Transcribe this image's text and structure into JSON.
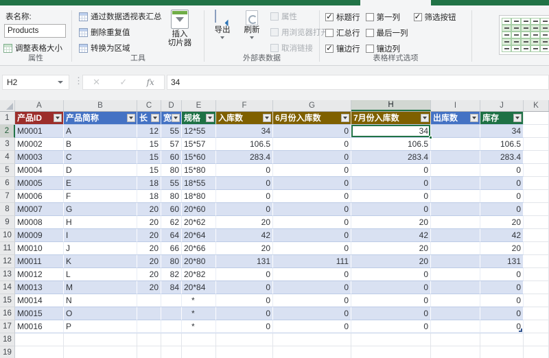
{
  "app": {
    "name": "Excel table tools ribbon - Design tab"
  },
  "colors": {
    "excel_green": "#217346",
    "header_red": "#9C2E2B",
    "header_blue": "#4472C4",
    "header_green": "#1E7145",
    "header_olive": "#7F6000",
    "banded_row_blue": "#D9E1F2"
  },
  "ribbon": {
    "properties_group": {
      "label": "属性",
      "table_name_label": "表名称:",
      "table_name_value": "Products",
      "resize_table": "调整表格大小"
    },
    "tools_group": {
      "label": "工具",
      "summarize_pivot": "通过数据透视表汇总",
      "remove_duplicates": "删除重复值",
      "convert_to_range": "转换为区域",
      "insert_slicer_line1": "插入",
      "insert_slicer_line2": "切片器"
    },
    "external_group": {
      "label": "外部表数据",
      "export": "导出",
      "refresh": "刷新",
      "properties_item": "属性",
      "open_in_browser": "用浏览器打开",
      "unlink": "取消链接"
    },
    "style_options_group": {
      "label": "表格样式选项",
      "checkbox_columns": [
        [
          {
            "label": "标题行",
            "checked": true
          },
          {
            "label": "汇总行",
            "checked": false
          },
          {
            "label": "镶边行",
            "checked": true
          }
        ],
        [
          {
            "label": "第一列",
            "checked": false
          },
          {
            "label": "最后一列",
            "checked": false
          },
          {
            "label": "镶边列",
            "checked": false
          }
        ],
        [
          {
            "label": "筛选按钮",
            "checked": true
          }
        ]
      ]
    }
  },
  "formula_bar": {
    "name_box": "H2",
    "cancel_icon": "✕",
    "enter_icon": "✓",
    "fx_icon": "fx",
    "formula_value": "34"
  },
  "grid": {
    "column_letters": [
      "A",
      "B",
      "C",
      "D",
      "E",
      "F",
      "G",
      "H",
      "I",
      "J",
      "K"
    ],
    "selected_column": "H",
    "selected_row": 2,
    "selected_cell": "H2",
    "table_headers": [
      {
        "label": "产品ID",
        "bg": "#9C2E2B"
      },
      {
        "label": "产品简称",
        "bg": "#4472C4"
      },
      {
        "label": "长",
        "bg": "#4472C4"
      },
      {
        "label": "宽",
        "bg": "#4472C4"
      },
      {
        "label": "规格",
        "bg": "#1E7145"
      },
      {
        "label": "入库数",
        "bg": "#7F6000"
      },
      {
        "label": "6月份入库数",
        "bg": "#7F6000"
      },
      {
        "label": "7月份入库数",
        "bg": "#7F6000"
      },
      {
        "label": "出库数",
        "bg": "#4472C4"
      },
      {
        "label": "库存",
        "bg": "#1E7145"
      }
    ],
    "rows": [
      {
        "n": 2,
        "cells": [
          "M0001",
          "A",
          "12",
          "55",
          "12*55",
          "34",
          "0",
          "34",
          "",
          "34"
        ]
      },
      {
        "n": 3,
        "cells": [
          "M0002",
          "B",
          "15",
          "57",
          "15*57",
          "106.5",
          "0",
          "106.5",
          "",
          "106.5"
        ]
      },
      {
        "n": 4,
        "cells": [
          "M0003",
          "C",
          "15",
          "60",
          "15*60",
          "283.4",
          "0",
          "283.4",
          "",
          "283.4"
        ]
      },
      {
        "n": 5,
        "cells": [
          "M0004",
          "D",
          "15",
          "80",
          "15*80",
          "0",
          "0",
          "0",
          "",
          "0"
        ]
      },
      {
        "n": 6,
        "cells": [
          "M0005",
          "E",
          "18",
          "55",
          "18*55",
          "0",
          "0",
          "0",
          "",
          "0"
        ]
      },
      {
        "n": 7,
        "cells": [
          "M0006",
          "F",
          "18",
          "80",
          "18*80",
          "0",
          "0",
          "0",
          "",
          "0"
        ]
      },
      {
        "n": 8,
        "cells": [
          "M0007",
          "G",
          "20",
          "60",
          "20*60",
          "0",
          "0",
          "0",
          "",
          "0"
        ]
      },
      {
        "n": 9,
        "cells": [
          "M0008",
          "H",
          "20",
          "62",
          "20*62",
          "20",
          "0",
          "20",
          "",
          "20"
        ]
      },
      {
        "n": 10,
        "cells": [
          "M0009",
          "I",
          "20",
          "64",
          "20*64",
          "42",
          "0",
          "42",
          "",
          "42"
        ]
      },
      {
        "n": 11,
        "cells": [
          "M0010",
          "J",
          "20",
          "66",
          "20*66",
          "20",
          "0",
          "20",
          "",
          "20"
        ]
      },
      {
        "n": 12,
        "cells": [
          "M0011",
          "K",
          "20",
          "80",
          "20*80",
          "131",
          "111",
          "20",
          "",
          "131"
        ]
      },
      {
        "n": 13,
        "cells": [
          "M0012",
          "L",
          "20",
          "82",
          "20*82",
          "0",
          "0",
          "0",
          "",
          "0"
        ]
      },
      {
        "n": 14,
        "cells": [
          "M0013",
          "M",
          "20",
          "84",
          "20*84",
          "0",
          "0",
          "0",
          "",
          "0"
        ]
      },
      {
        "n": 15,
        "cells": [
          "M0014",
          "N",
          "",
          "",
          "*",
          "0",
          "0",
          "0",
          "",
          "0"
        ]
      },
      {
        "n": 16,
        "cells": [
          "M0015",
          "O",
          "",
          "",
          "*",
          "0",
          "0",
          "0",
          "",
          "0"
        ]
      },
      {
        "n": 17,
        "cells": [
          "M0016",
          "P",
          "",
          "",
          "*",
          "0",
          "0",
          "0",
          "",
          "0"
        ]
      },
      {
        "n": 18,
        "cells": []
      },
      {
        "n": 19,
        "cells": []
      }
    ]
  }
}
